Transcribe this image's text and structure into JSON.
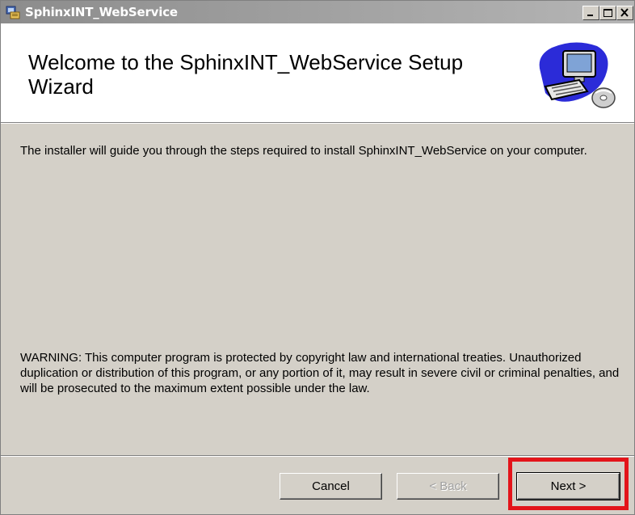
{
  "window": {
    "title": "SphinxINT_WebService",
    "controls": {
      "minimize_icon": "minimize-icon",
      "maximize_icon": "maximize-icon",
      "close_icon": "close-icon"
    }
  },
  "header": {
    "heading": "Welcome to the SphinxINT_WebService Setup Wizard",
    "art_icon": "computer-setup-icon"
  },
  "body": {
    "intro": "The installer will guide you through the steps required to install SphinxINT_WebService on your computer.",
    "warning": "WARNING: This computer program is protected by copyright law and international treaties. Unauthorized duplication or distribution of this program, or any portion of it, may result in severe civil or criminal penalties, and will be prosecuted to the maximum extent possible under the law."
  },
  "buttons": {
    "cancel": "Cancel",
    "back": "< Back",
    "next": "Next >"
  },
  "colors": {
    "dialog_face": "#d4d0c8",
    "titlebar_inactive": "#a0a0a0",
    "highlight": "#e3141a"
  }
}
